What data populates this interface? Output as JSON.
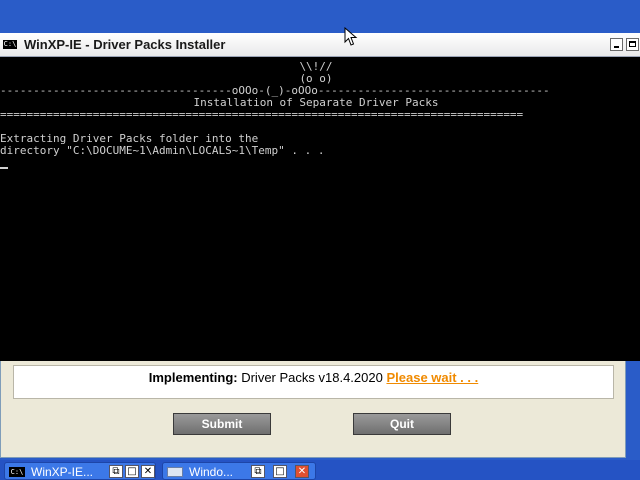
{
  "console_window": {
    "title": "WinXP-IE - Driver Packs Installer",
    "icon": "cmd-icon",
    "icon_text": "C:\\",
    "lines": {
      "art1": "\\\\!//",
      "art2": "(o o)",
      "art3": "-----------------------------------oOOo-(_)-oOOo-----------------------------------",
      "heading": "Installation of Separate Driver Packs",
      "rule": "===============================================================================",
      "msg1": "Extracting Driver Packs folder into the",
      "msg2": "directory \"C:\\DOCUME~1\\Admin\\LOCALS~1\\Temp\" . . ."
    }
  },
  "installer_dialog": {
    "implementing_label": "Implementing:",
    "implementing_value": "Driver Packs v18.4.2020",
    "status": "Please wait . . .",
    "submit_label": "Submit",
    "quit_label": "Quit"
  },
  "taskbar": {
    "tasks": [
      {
        "label": "WinXP-IE...",
        "icon": "cmd-icon",
        "icon_text": "C:\\"
      },
      {
        "label": "Windo...",
        "icon": "window-icon"
      }
    ]
  },
  "colors": {
    "desktop": "#2a5cc8",
    "console_bg": "#000000",
    "status_orange": "#f08a00",
    "taskbar": "#2553c4"
  }
}
